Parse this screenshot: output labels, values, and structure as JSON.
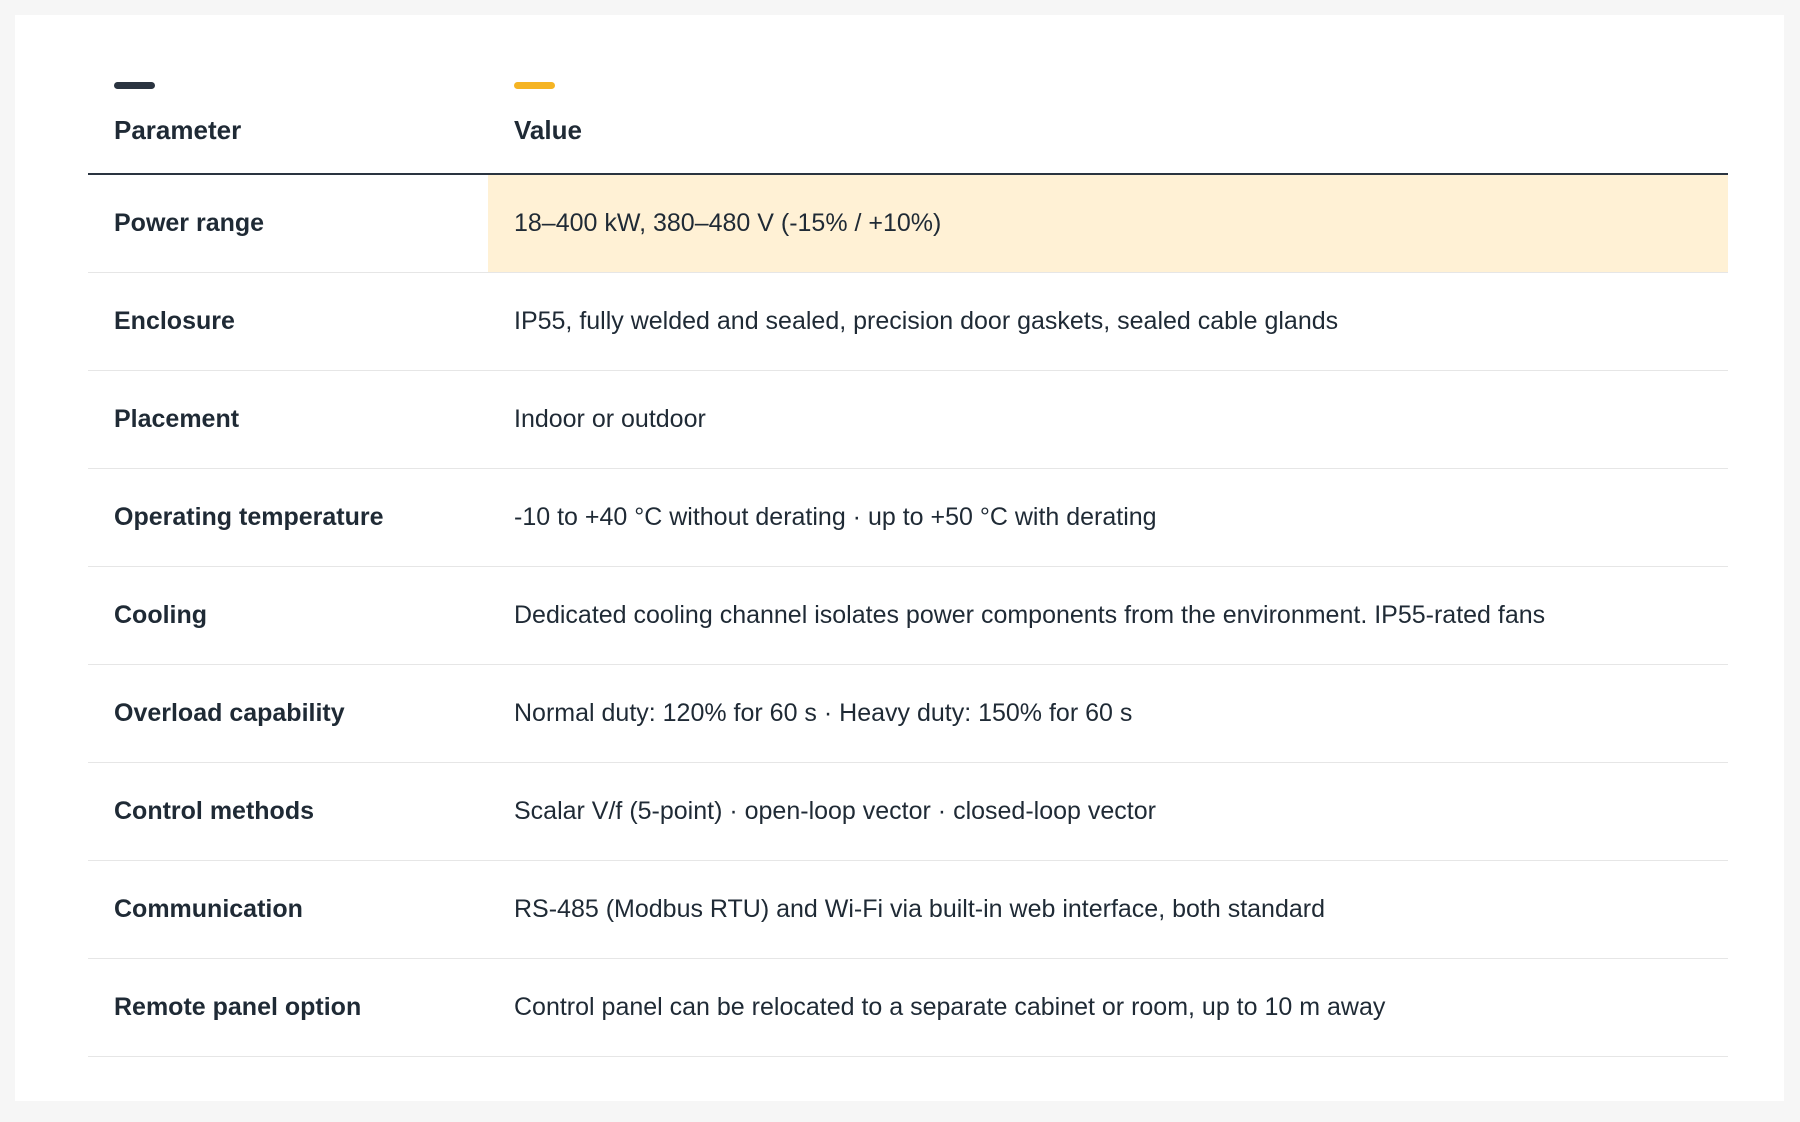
{
  "table": {
    "header": {
      "parameter": "Parameter",
      "value": "Value"
    },
    "accent_colors": {
      "parameter": "#2a3440",
      "value": "#f5b423"
    },
    "highlight_color": "#fff1d5",
    "rows": [
      {
        "parameter": "Power range",
        "value": "18–400 kW, 380–480 V (-15% / +10%)"
      },
      {
        "parameter": "Enclosure",
        "value": "IP55, fully welded and sealed, precision door gaskets, sealed cable glands"
      },
      {
        "parameter": "Placement",
        "value": "Indoor or outdoor"
      },
      {
        "parameter": "Operating temperature",
        "value": "-10 to +40 °C without derating · up to +50 °C with derating"
      },
      {
        "parameter": "Cooling",
        "value": "Dedicated cooling channel isolates power components from the environment. IP55-rated fans"
      },
      {
        "parameter": "Overload capability",
        "value": "Normal duty: 120% for 60 s · Heavy duty: 150% for 60 s"
      },
      {
        "parameter": "Control methods",
        "value": "Scalar V/f (5-point) · open-loop vector · closed-loop vector"
      },
      {
        "parameter": "Communication",
        "value": "RS-485 (Modbus RTU) and Wi-Fi via built-in web interface, both standard"
      },
      {
        "parameter": "Remote panel option",
        "value": "Control panel can be relocated to a separate cabinet or room, up to 10 m away"
      }
    ]
  }
}
